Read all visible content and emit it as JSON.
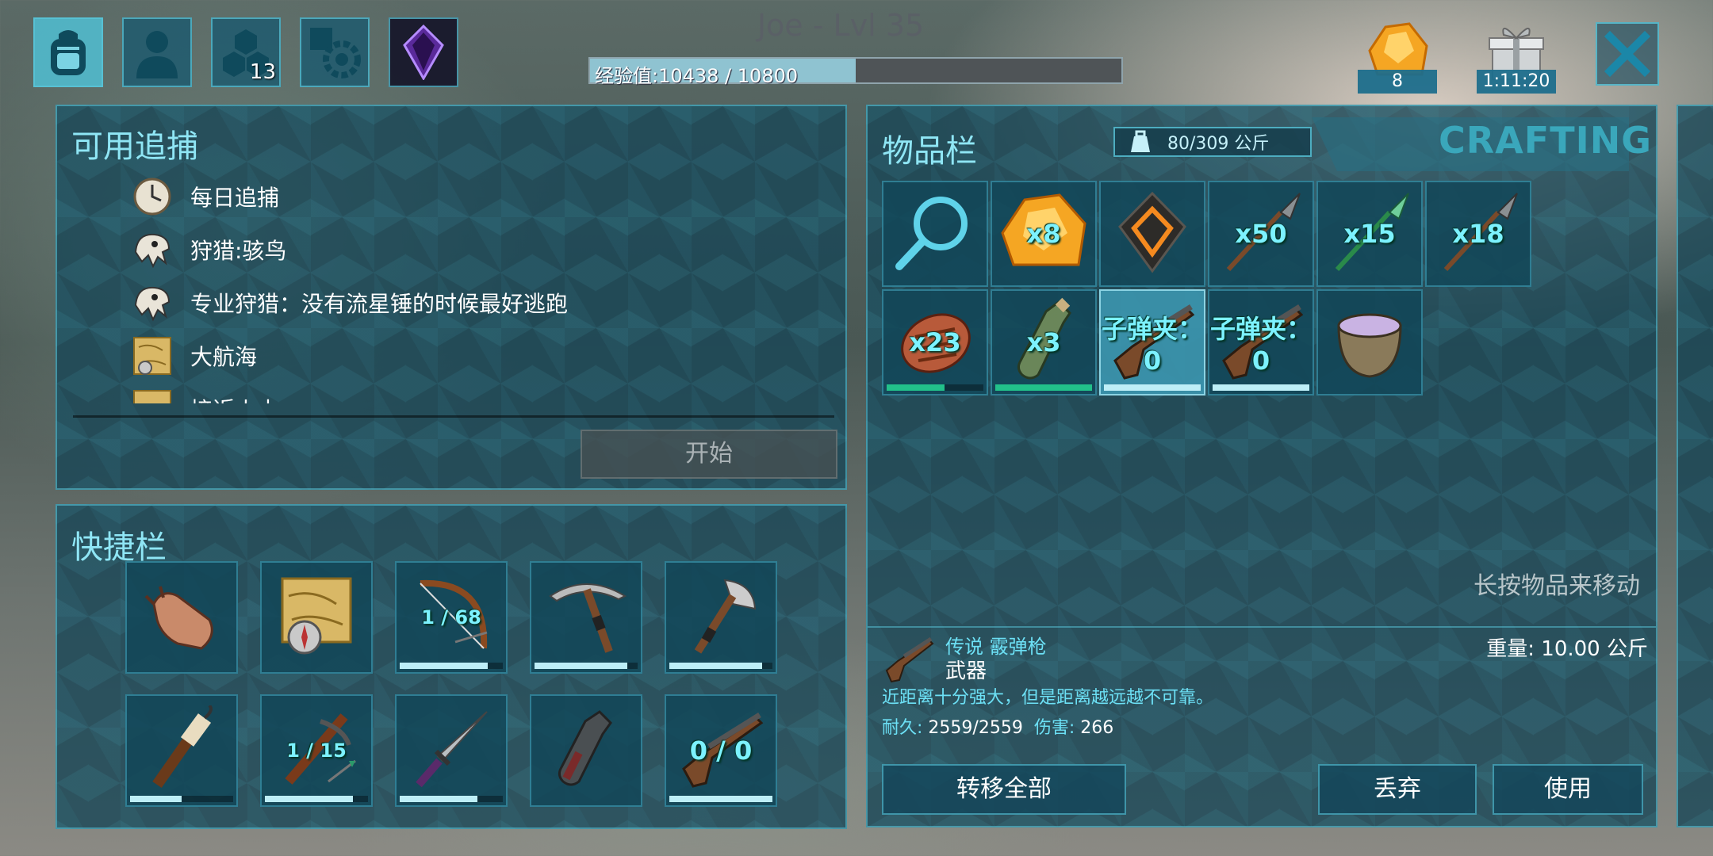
{
  "top_bar": {
    "tabs": [
      {
        "name": "inventory-tab",
        "icon": "backpack-icon",
        "active": true
      },
      {
        "name": "character-tab",
        "icon": "person-icon"
      },
      {
        "name": "engrams-tab",
        "icon": "hexagons-icon",
        "badge": "13"
      },
      {
        "name": "settings-tab",
        "icon": "gear-icon"
      },
      {
        "name": "element-tab",
        "icon": "crystal-icon"
      }
    ],
    "player_title": "Joe - Lvl 35",
    "xp_text": "经验值:10438 / 10800",
    "xp_current": 10438,
    "xp_max": 10800,
    "amber_count": "8",
    "gift_timer": "1:11:20"
  },
  "hunts_panel": {
    "title": "可用追捕",
    "items": [
      {
        "icon": "clock-icon",
        "label": "每日追捕"
      },
      {
        "icon": "dino-skull-icon",
        "label": "狩猎:骇鸟"
      },
      {
        "icon": "dino-skull-icon",
        "label": "专业狩猎：没有流星锤的时候最好逃跑"
      },
      {
        "icon": "treasure-map-icon",
        "label": "大航海"
      },
      {
        "icon": "treasure-map-icon",
        "label": "接近火山"
      }
    ],
    "start_label": "开始"
  },
  "hotbar": {
    "title": "快捷栏",
    "slots": [
      {
        "icon": "hand-icon",
        "qty": "",
        "bar": null
      },
      {
        "icon": "map-compass-icon",
        "qty": "",
        "bar": null
      },
      {
        "icon": "bow-icon",
        "qty": "1 / 68",
        "bar": 0.85,
        "bar_color": "#bdeef7"
      },
      {
        "icon": "pickaxe-icon",
        "qty": "",
        "bar": 0.9,
        "bar_color": "#bdeef7"
      },
      {
        "icon": "hatchet-icon",
        "qty": "",
        "bar": 0.9,
        "bar_color": "#bdeef7"
      },
      {
        "icon": "torch-icon",
        "qty": "",
        "bar": 0.5,
        "bar_color": "#bdeef7"
      },
      {
        "icon": "crossbow-icon",
        "qty": "1 / 15",
        "bar": 0.85,
        "bar_color": "#bdeef7"
      },
      {
        "icon": "sword-icon",
        "qty": "",
        "bar": 0.75,
        "bar_color": "#bdeef7"
      },
      {
        "icon": "bottle-icon",
        "qty": "",
        "bar": null
      },
      {
        "icon": "shotgun-icon",
        "qty": "0 / 0",
        "bar": 1.0,
        "bar_color": "#bdeef7"
      }
    ]
  },
  "inventory": {
    "title": "物品栏",
    "weight": "80/309 公斤",
    "crafting_label": "CRAFTING",
    "slots": [
      {
        "icon": "search-icon",
        "qty": "",
        "bar": null
      },
      {
        "icon": "amber-icon",
        "qty": "x8",
        "bar": null
      },
      {
        "icon": "element-shard-icon",
        "qty": "",
        "bar": null
      },
      {
        "icon": "spear-stone-icon",
        "qty": "x50",
        "bar": null
      },
      {
        "icon": "spear-green-icon",
        "qty": "x15",
        "bar": null
      },
      {
        "icon": "spear-stone-icon",
        "qty": "x18",
        "bar": null
      },
      {
        "icon": "cooked-meat-icon",
        "qty": "x23",
        "bar": 0.6,
        "bar_color": "#22c08a"
      },
      {
        "icon": "water-bottle-icon",
        "qty": "x3",
        "bar": 1.0,
        "bar_color": "#22c08a"
      },
      {
        "icon": "shotgun-icon",
        "qty": "子弹夹：0",
        "bar": 1.0,
        "bar_color": "#bdeef7",
        "selected": true
      },
      {
        "icon": "shotgun-icon",
        "qty": "子弹夹：0",
        "bar": 1.0,
        "bar_color": "#bdeef7"
      },
      {
        "icon": "mortar-icon",
        "qty": "",
        "bar": null
      }
    ],
    "hint": "长按物品来移动",
    "detail": {
      "name": "传说 霰弹枪",
      "type": "武器",
      "weight": "重量: 10.00 公斤",
      "description": "近距离十分强大，但是距离越远越不可靠。",
      "durability_label": "耐久:",
      "durability": "2559/2559",
      "damage_label": "伤害:",
      "damage": "266"
    },
    "actions": {
      "transfer_all": "转移全部",
      "drop": "丢弃",
      "use": "使用"
    }
  },
  "colors": {
    "accent": "#8fe6f5",
    "qty_text": "#7cf2ff",
    "panel_border": "#5ac8dc"
  }
}
